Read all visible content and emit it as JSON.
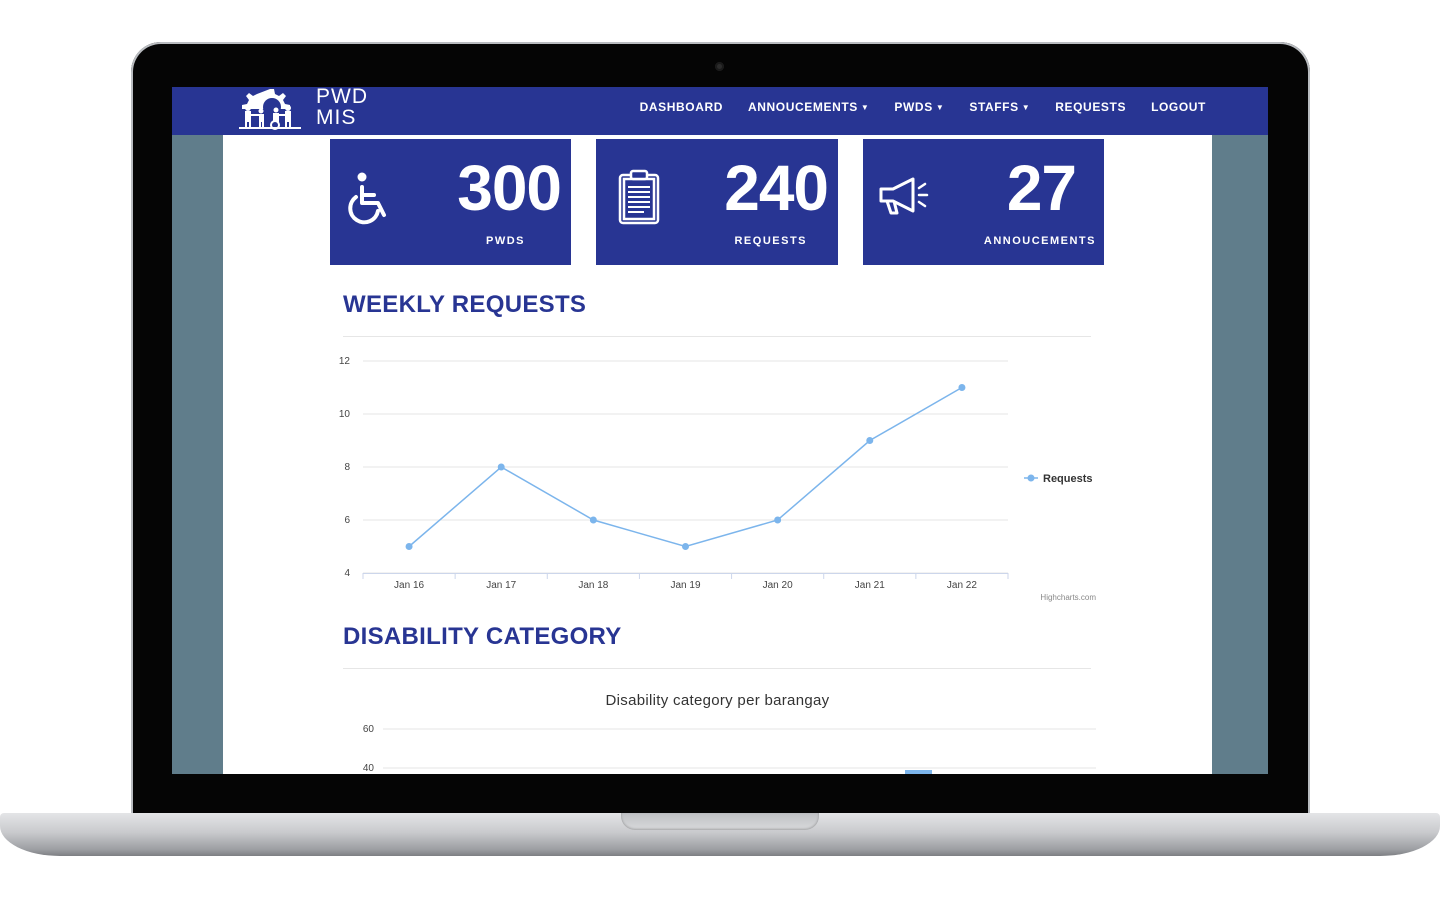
{
  "brand": {
    "line1": "PWD",
    "line2": "MIS"
  },
  "nav": {
    "dashboard": "DASHBOARD",
    "announcements": "ANNOUCEMENTS",
    "pwds": "PWDS",
    "staffs": "STAFFS",
    "requests": "REQUESTS",
    "logout": "LOGOUT"
  },
  "cards": {
    "pwds": {
      "value": "300",
      "label": "PWDS",
      "icon": "wheelchair-icon"
    },
    "requests": {
      "value": "240",
      "label": "REQUESTS",
      "icon": "clipboard-icon"
    },
    "announcements": {
      "value": "27",
      "label": "ANNOUCEMENTS",
      "icon": "megaphone-icon"
    }
  },
  "sections": {
    "weekly": "WEEKLY REQUESTS",
    "disability": "DISABILITY CATEGORY"
  },
  "colors": {
    "primary": "#283593",
    "series": "#7cb5ec",
    "side": "#607d8b"
  },
  "chart_data": [
    {
      "type": "line",
      "title": "",
      "x": [
        "Jan 16",
        "Jan 17",
        "Jan 18",
        "Jan 19",
        "Jan 20",
        "Jan 21",
        "Jan 22"
      ],
      "series": [
        {
          "name": "Requests",
          "values": [
            5,
            8,
            6,
            5,
            6,
            9,
            11
          ]
        }
      ],
      "yticks": [
        4,
        6,
        8,
        10,
        12
      ],
      "ylim": [
        4,
        12
      ],
      "grid": true,
      "legend": "right",
      "credit": "Highcharts.com"
    },
    {
      "type": "bar",
      "title": "Disability category per barangay",
      "yticks": [
        40,
        60
      ],
      "grid": true
    }
  ]
}
